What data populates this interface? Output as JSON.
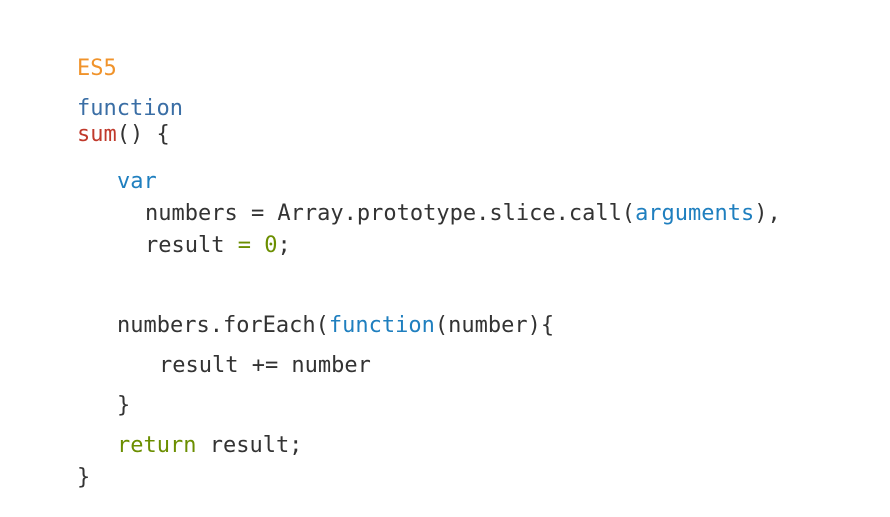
{
  "label": "ES5",
  "lines": {
    "l1": {
      "kw": "function",
      "fn": "sum",
      "rest": "() {"
    },
    "l2": {
      "kw": "var"
    },
    "l3": {
      "a": "numbers = Array.prototype.slice.call(",
      "b": "arguments",
      "c": "),"
    },
    "l4": {
      "a": "result ",
      "b": "= 0",
      "c": ";"
    },
    "l5": {
      "a": "numbers.forEach(",
      "b": "function",
      "c": "(number){"
    },
    "l6": {
      "a": "result += number"
    },
    "l7": {
      "a": "}"
    },
    "l8": {
      "kw": "return",
      "rest": " result;"
    },
    "l9": {
      "a": "}"
    }
  },
  "colors": {
    "label": "#f0932b",
    "keyword": "#3a6ea5",
    "function_name": "#c0392b",
    "blue": "#1f7fbf",
    "green": "#6b8e00",
    "text": "#333333"
  }
}
